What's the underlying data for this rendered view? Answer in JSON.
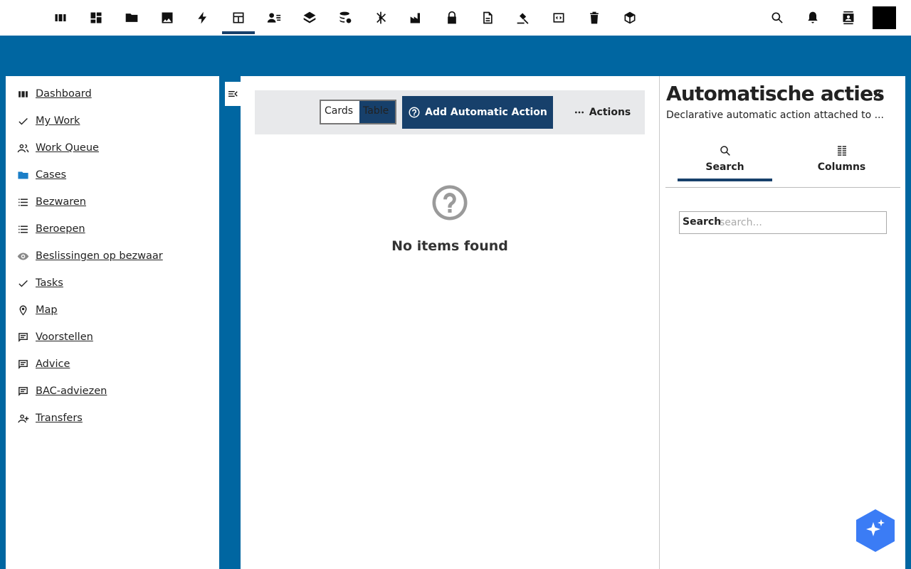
{
  "topbar": {
    "icons": [
      "view-columns-icon",
      "dashboard-icon",
      "folder-icon",
      "image-icon",
      "bolt-icon",
      "table-chart-icon",
      "person-list-icon",
      "layers-icon",
      "database-sync-icon",
      "hub-icon",
      "factory-icon",
      "lock-icon",
      "document-icon",
      "gavel-icon",
      "code-window-icon",
      "trash-icon",
      "cube-icon"
    ],
    "right_icons": [
      "search-icon",
      "notifications-icon",
      "contact-icon"
    ]
  },
  "sidenav": {
    "items": [
      {
        "label": "Dashboard",
        "icon": "view-columns-icon"
      },
      {
        "label": "My Work",
        "icon": "check-icon"
      },
      {
        "label": "Work Queue",
        "icon": "people-icon"
      },
      {
        "label": "Cases",
        "icon": "folder-icon",
        "color": "#1a7ec7"
      },
      {
        "label": "Bezwaren",
        "icon": "list-icon"
      },
      {
        "label": "Beroepen",
        "icon": "list-icon"
      },
      {
        "label": "Beslissingen op bezwaar",
        "icon": "eye-icon"
      },
      {
        "label": "Tasks",
        "icon": "check-icon"
      },
      {
        "label": "Map",
        "icon": "location-icon"
      },
      {
        "label": "Voorstellen",
        "icon": "comment-icon"
      },
      {
        "label": "Advice",
        "icon": "comment-icon"
      },
      {
        "label": "BAC-adviezen",
        "icon": "comment-icon"
      },
      {
        "label": "Transfers",
        "icon": "person-add-icon"
      }
    ]
  },
  "main": {
    "toggle": {
      "cards": "Cards",
      "table": "Table"
    },
    "add_button": "Add Automatic Action",
    "actions_button": "Actions",
    "empty_text": "No items found"
  },
  "panel": {
    "title": "Automatische acties",
    "subtitle": "Declarative automatic action attached to ...",
    "tabs": [
      {
        "label": "Search"
      },
      {
        "label": "Columns"
      }
    ],
    "search_label": "Search",
    "search_placeholder": "search..."
  },
  "colors": {
    "brand_blue": "#0066a1",
    "navy": "#17406b",
    "fab": "#3b7cf5"
  }
}
